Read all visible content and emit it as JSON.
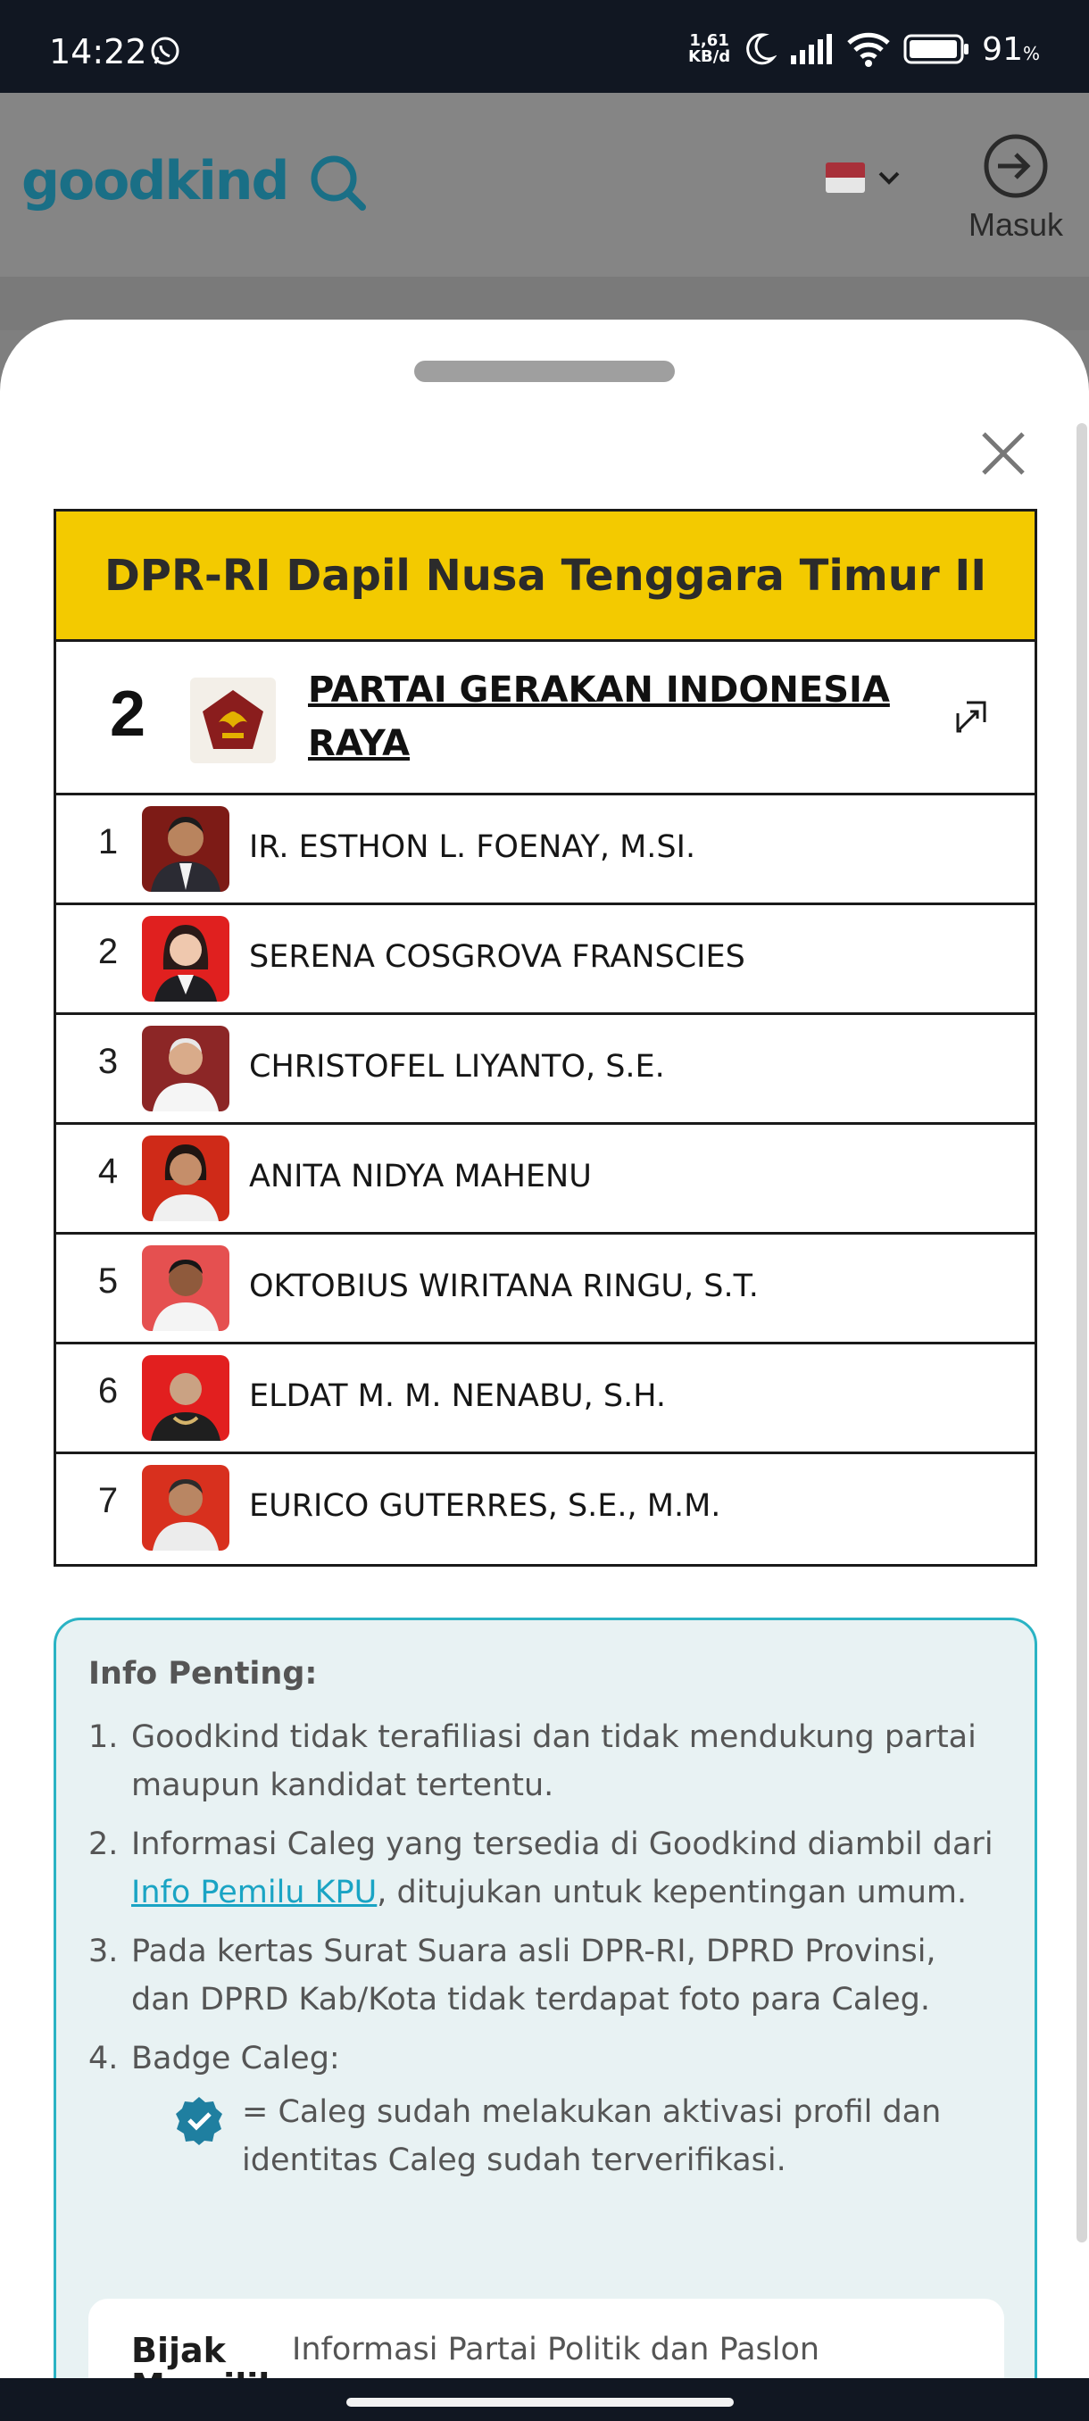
{
  "status_bar": {
    "time": "14:22",
    "net_speed_value": "1,61",
    "net_speed_unit": "KB/d",
    "battery": "91",
    "battery_unit": "%"
  },
  "header": {
    "logo": "goodkind",
    "login_label": "Masuk"
  },
  "party_table": {
    "title": "DPR-RI Dapil Nusa Tenggara Timur II",
    "party_number": "2",
    "party_name": "PARTAI GERAKAN INDONESIA RAYA",
    "candidates": [
      {
        "no": "1",
        "name": "IR. ESTHON L. FOENAY, M.SI."
      },
      {
        "no": "2",
        "name": "SERENA COSGROVA FRANSCIES"
      },
      {
        "no": "3",
        "name": "CHRISTOFEL LIYANTO, S.E."
      },
      {
        "no": "4",
        "name": "ANITA NIDYA MAHENU"
      },
      {
        "no": "5",
        "name": "OKTOBIUS WIRITANA RINGU, S.T."
      },
      {
        "no": "6",
        "name": "ELDAT M. M. NENABU, S.H."
      },
      {
        "no": "7",
        "name": "EURICO GUTERRES, S.E., M.M."
      }
    ]
  },
  "info": {
    "title": "Info Penting:",
    "item1": "Goodkind tidak terafiliasi dan tidak mendukung partai maupun kandidat tertentu.",
    "item2_before": "Informasi Caleg yang tersedia di Goodkind diambil dari ",
    "item2_link": "Info Pemilu KPU",
    "item2_after": ", ditujukan untuk kepentingan umum.",
    "item3": "Pada kertas Surat Suara asli DPR-RI, DPRD Provinsi, dan DPRD Kab/Kota tidak terdapat foto para Caleg.",
    "item4": "Badge Caleg:",
    "badge_text": "= Caleg sudah melakukan aktivasi profil dan identitas Caleg sudah terverifikasi.",
    "bijak_logo_line1": "Bijak",
    "bijak_logo_line2": "Memilih",
    "bijak_text": "Informasi Partai Politik dan Paslon"
  },
  "colors": {
    "title_bar": "#f3ca00",
    "brand": "#1a6f86",
    "info_border": "#2ab3c4"
  }
}
